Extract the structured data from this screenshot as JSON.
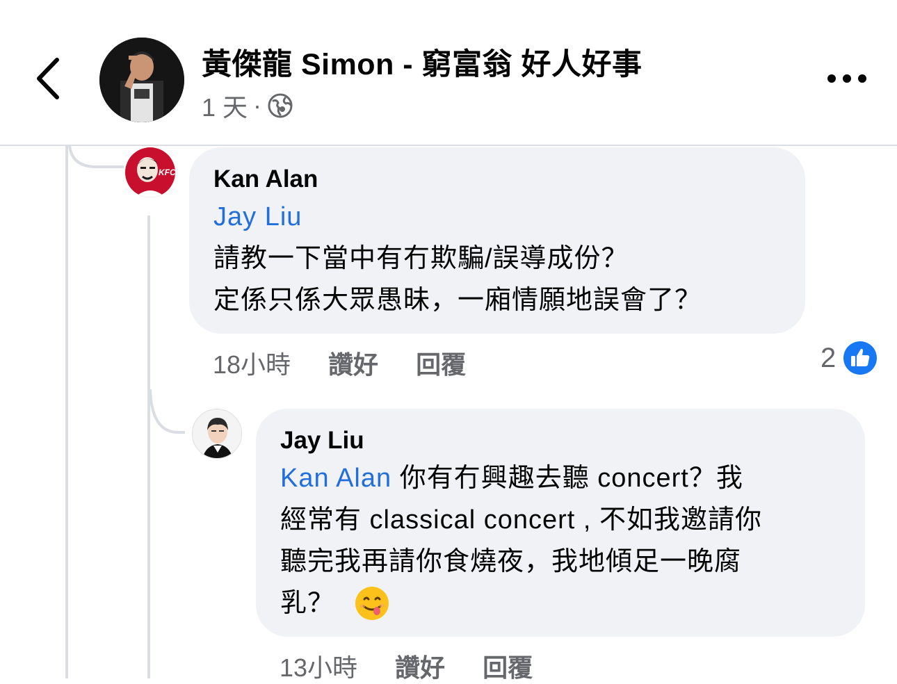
{
  "header": {
    "page_name": "黃傑龍 Simon - 窮富翁 好人好事",
    "time": "1 天",
    "separator": "·",
    "privacy_icon": "globe-icon",
    "back_icon": "chevron-left-icon",
    "more_icon": "more-dots-icon"
  },
  "comments": [
    {
      "author": "Kan Alan",
      "avatar_icon": "kfc-avatar",
      "mention": "Jay Liu",
      "lines": [
        "請教一下當中有冇欺騙/誤導成份？",
        "定係只係大眾愚昧，一廂情願地誤會了？"
      ],
      "time": "18小時",
      "like_label": "讚好",
      "reply_label": "回覆",
      "reaction_count": "2",
      "reaction_icon": "like-thumb-icon"
    },
    {
      "author": "Jay Liu",
      "avatar_icon": "person-avatar",
      "mention": "Kan Alan",
      "lines": [
        " 你有冇興趣去聽 concert？我",
        "經常有 classical concert , 不如我邀請你",
        "聽完我再請你食燒夜，我地傾足一晚腐",
        "乳？ "
      ],
      "emoji": "😋",
      "time": "13小時",
      "like_label": "讚好",
      "reply_label": "回覆"
    }
  ],
  "colors": {
    "link": "#216fdb",
    "like_blue": "#1877f2",
    "bubble": "#f0f2f5",
    "secondary_text": "#65676b"
  }
}
